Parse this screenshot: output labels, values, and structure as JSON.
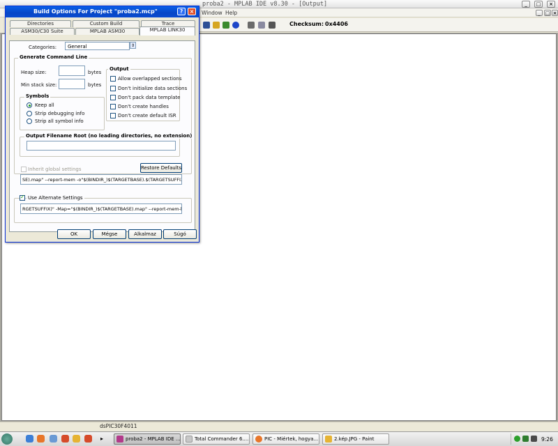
{
  "ide": {
    "title": "proba2 - MPLAB IDE v8.30 - [Output]",
    "menu": [
      "Window",
      "Help"
    ],
    "checksum_label": "Checksum:",
    "checksum_value": "0x4406",
    "status_device": "dsPIC30F4011"
  },
  "dialog": {
    "title": "Build Options For Project \"proba2.mcp\"",
    "help_btn": "?",
    "close_btn": "×",
    "tabs_row1": [
      "Directories",
      "Custom Build",
      "Trace"
    ],
    "tabs_row2": [
      "ASM30/C30 Suite",
      "MPLAB ASM30",
      "MPLAB LINK30"
    ],
    "active_tab": "MPLAB LINK30",
    "categories_label": "Categories:",
    "categories_value": "General",
    "generate_group": "Generate Command Line",
    "heap_label": "Heap size:",
    "heap_value": "",
    "heap_unit": "bytes",
    "stack_label": "Min stack size:",
    "stack_value": "",
    "stack_unit": "bytes",
    "symbols_group": "Symbols",
    "symbols": [
      {
        "label": "Keep all",
        "checked": true
      },
      {
        "label": "Strip debugging info",
        "checked": false
      },
      {
        "label": "Strip all symbol info",
        "checked": false
      }
    ],
    "output_group": "Output",
    "output_options": [
      {
        "label": "Allow overlapped sections",
        "checked": false
      },
      {
        "label": "Don't initialize data sections",
        "checked": false
      },
      {
        "label": "Don't pack data template",
        "checked": false
      },
      {
        "label": "Don't create handles",
        "checked": false
      },
      {
        "label": "Don't create default ISR",
        "checked": false
      }
    ],
    "filename_group": "Output Filename Root (no leading directories, no extension)",
    "filename_value": "",
    "inherit_label": "Inherit global settings",
    "restore_btn": "Restore Defaults",
    "cmdline_value": "SE).map\" --report-mem -o\"$(BINDIR_)$(TARGETBASE).$(TARGETSUFFIX)\"",
    "alt_settings_label": "Use Alternate Settings",
    "alt_cmdline_value": "RGETSUFFIX)\" -Map=\"$(BINDIR_)$(TARGETBASE).map\" --report-mem-ldsp",
    "buttons": [
      "OK",
      "Mégse",
      "Alkalmaz",
      "Súgó"
    ]
  },
  "taskbar": {
    "tasks": [
      {
        "label": "proba2 - MPLAB IDE ...",
        "active": true
      },
      {
        "label": "Total Commander 6....",
        "active": false
      },
      {
        "label": "PIC - Miértek, hogya...",
        "active": false
      },
      {
        "label": "2.kép.JPG - Paint",
        "active": false
      }
    ],
    "clock": "9:26"
  },
  "colors": {
    "dialog_titlebar": "#0746c7",
    "workspace": "#a7a69e",
    "output_bg": "#ffffff"
  }
}
